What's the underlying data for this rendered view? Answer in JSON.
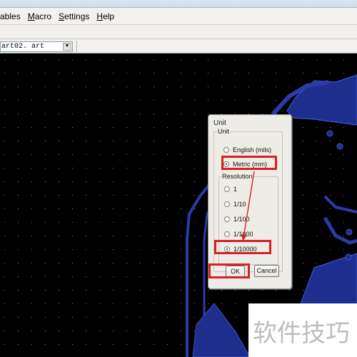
{
  "menubar": {
    "items": [
      {
        "label": "ables",
        "accel": ""
      },
      {
        "label": "Macro",
        "accel": "M"
      },
      {
        "label": "Settings",
        "accel": "S"
      },
      {
        "label": "Help",
        "accel": "H"
      }
    ]
  },
  "filebar": {
    "file_value": "art02. art"
  },
  "dialog": {
    "title": "Unit",
    "unit_group_label": "Unit",
    "unit_options": [
      {
        "label": "English (mils)",
        "selected": false
      },
      {
        "label": "Metric (mm)",
        "selected": true
      }
    ],
    "resolution_group_label": "Resolution",
    "resolution_options": [
      {
        "label": "1",
        "selected": false
      },
      {
        "label": "1/10",
        "selected": false
      },
      {
        "label": "1/100",
        "selected": false
      },
      {
        "label": "1/1000",
        "selected": false
      },
      {
        "label": "1/10000",
        "selected": true
      }
    ],
    "ok_label": "OK",
    "cancel_label": "Cancel"
  },
  "watermark": {
    "text": "软件技巧"
  },
  "colors": {
    "annotation_red": "#d81e26",
    "pcb_blue": "#1e2e8c",
    "pcb_edge": "#3f55d0",
    "grid_dot": "#8a8a8a"
  },
  "icons": [
    "combo-arrow-icon"
  ]
}
